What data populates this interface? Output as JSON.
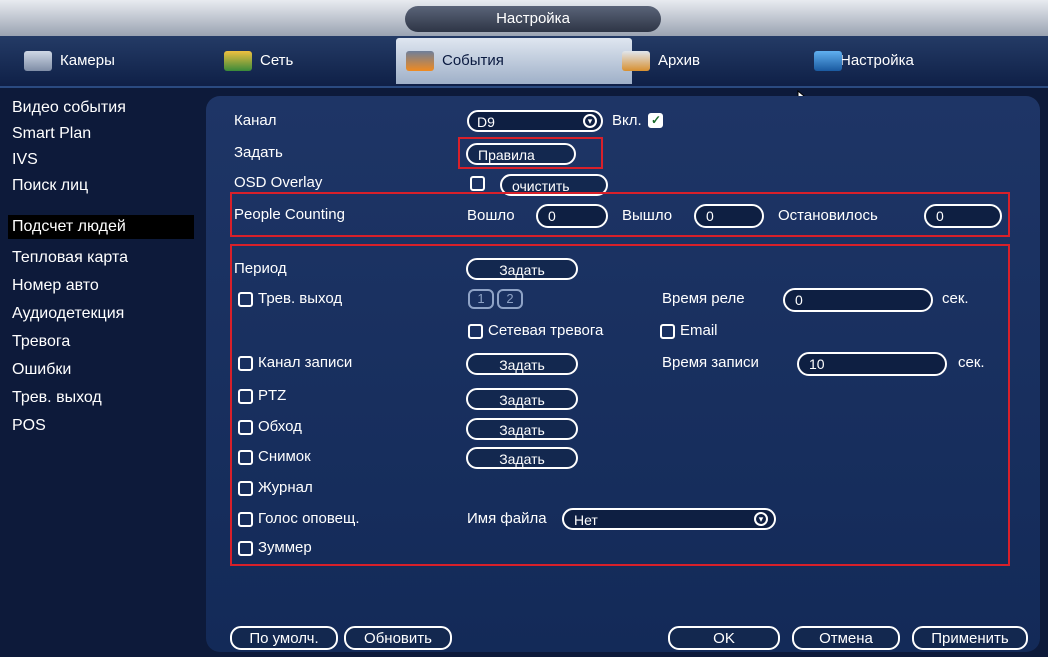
{
  "window": {
    "title": "Настройка"
  },
  "tabs": [
    {
      "label": "Камеры",
      "icon": "camera-icon"
    },
    {
      "label": "Сеть",
      "icon": "network-icon"
    },
    {
      "label": "События",
      "icon": "events-icon",
      "active": true
    },
    {
      "label": "Архив",
      "icon": "archive-icon"
    },
    {
      "label": "Настройка",
      "icon": "settings-icon"
    }
  ],
  "sidebar": {
    "items": [
      {
        "label": "Видео события"
      },
      {
        "label": "Smart Plan"
      },
      {
        "label": "IVS"
      },
      {
        "label": "Поиск лиц"
      },
      {
        "label": "Подсчет людей",
        "active": true
      },
      {
        "label": "Тепловая карта"
      },
      {
        "label": "Номер авто"
      },
      {
        "label": "Аудиодетекция"
      },
      {
        "label": "Тревога"
      },
      {
        "label": "Ошибки"
      },
      {
        "label": "Трев. выход"
      },
      {
        "label": "POS"
      }
    ]
  },
  "form": {
    "channel_label": "Канал",
    "channel_value": "D9",
    "enable_label": "Вкл.",
    "enable_checked": true,
    "set_label": "Задать",
    "rules_button": "Правила",
    "osd_label": "OSD Overlay",
    "clear_button": "очистить",
    "people_counting_label": "People Counting",
    "entered_label": "Вошло",
    "entered_value": "0",
    "exited_label": "Вышло",
    "exited_value": "0",
    "stayed_label": "Остановилось",
    "stayed_value": "0",
    "period_label": "Период",
    "set_button": "Задать",
    "alarm_out_label": "Трев. выход",
    "alarm_out_ch1": "1",
    "alarm_out_ch2": "2",
    "relay_time_label": "Время реле",
    "relay_time_value": "0",
    "sec_label": "сек.",
    "net_alarm_label": "Сетевая тревога",
    "email_label": "Email",
    "record_channel_label": "Канал записи",
    "record_time_label": "Время записи",
    "record_time_value": "10",
    "ptz_label": "PTZ",
    "tour_label": "Обход",
    "snapshot_label": "Снимок",
    "log_label": "Журнал",
    "voice_label": "Голос оповещ.",
    "file_name_label": "Имя файла",
    "file_name_value": "Нет",
    "buzzer_label": "Зуммер"
  },
  "footer": {
    "default_button": "По умолч.",
    "refresh_button": "Обновить",
    "ok_button": "OK",
    "cancel_button": "Отмена",
    "apply_button": "Применить"
  },
  "colors": {
    "highlight": "#d8202a",
    "background": "#0d1a3a",
    "panel": "#1a3060"
  }
}
